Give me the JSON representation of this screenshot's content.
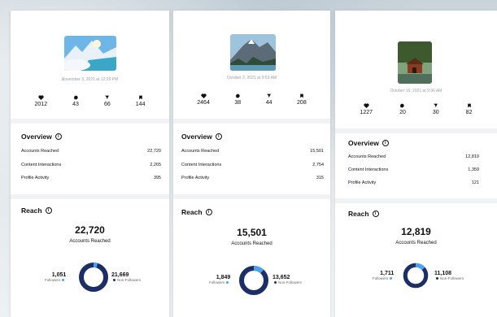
{
  "colors": {
    "followers": "#4aa3f0",
    "non_followers": "#1b2f66"
  },
  "posts": [
    {
      "date": "November 3, 2021 at 12:29 PM",
      "likes": "2012",
      "comments": "43",
      "shares": "66",
      "saves": "144",
      "overview_title": "Overview",
      "accounts_reached_label": "Accounts Reached",
      "accounts_reached": "22,720",
      "content_interactions_label": "Content Interactions",
      "content_interactions": "2,265",
      "profile_activity_label": "Profile Activity",
      "profile_activity": "395",
      "reach_title": "Reach",
      "reach_total": "22,720",
      "reach_sub": "Accounts Reached",
      "followers": "1,051",
      "followers_label": "Followers",
      "non_followers": "21,669",
      "non_followers_label": "Non-Followers",
      "followers_fraction": 0.046
    },
    {
      "date": "October 2, 2021 at 9:53 AM",
      "likes": "2464",
      "comments": "38",
      "shares": "44",
      "saves": "208",
      "overview_title": "Overview",
      "accounts_reached_label": "Accounts Reached",
      "accounts_reached": "15,501",
      "content_interactions_label": "Content Interactions",
      "content_interactions": "2,754",
      "profile_activity_label": "Profile Activity",
      "profile_activity": "315",
      "reach_title": "Reach",
      "reach_total": "15,501",
      "reach_sub": "Accounts Reached",
      "followers": "1,849",
      "followers_label": "Followers",
      "non_followers": "13,652",
      "non_followers_label": "Non-Followers",
      "followers_fraction": 0.119
    },
    {
      "date": "October 16, 2021 at 9:36 AM",
      "likes": "1227",
      "comments": "20",
      "shares": "30",
      "saves": "82",
      "overview_title": "Overview",
      "accounts_reached_label": "Accounts Reached",
      "accounts_reached": "12,819",
      "content_interactions_label": "Content Interactions",
      "content_interactions": "1,359",
      "profile_activity_label": "Profile Activity",
      "profile_activity": "121",
      "reach_title": "Reach",
      "reach_total": "12,819",
      "reach_sub": "Accounts Reached",
      "followers": "1,711",
      "followers_label": "Followers",
      "non_followers": "11,108",
      "non_followers_label": "Non-Followers",
      "followers_fraction": 0.133
    }
  ]
}
